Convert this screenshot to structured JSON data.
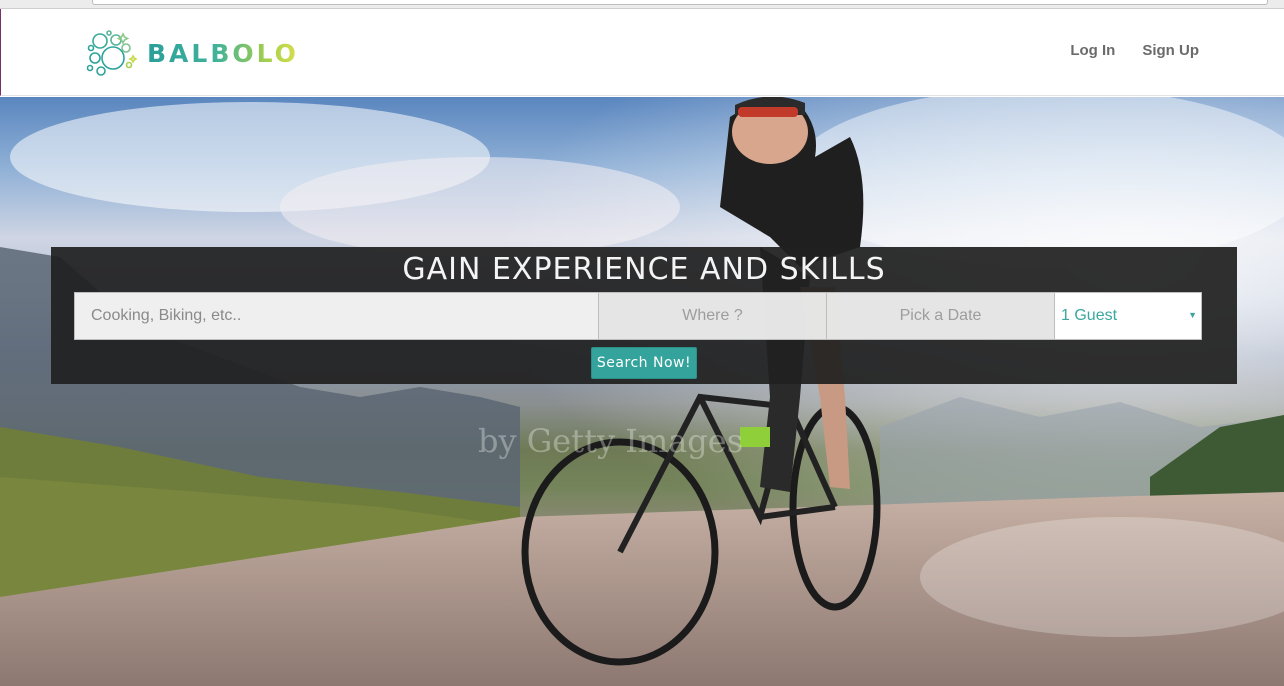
{
  "brand": {
    "name": "BALBOLO"
  },
  "nav": {
    "login_label": "Log In",
    "signup_label": "Sign Up"
  },
  "hero": {
    "title": "GAIN EXPERIENCE AND SKILLS",
    "watermark": "by Getty Images",
    "search": {
      "activity_placeholder": "Cooking, Biking, etc..",
      "location_placeholder": "Where ?",
      "date_placeholder": "Pick a Date",
      "guests_value": "1 Guest",
      "button_label": "Search Now!"
    }
  },
  "colors": {
    "accent": "#34a39c",
    "nav_text": "#6b6b6b",
    "panel": "#202020"
  },
  "icons": {
    "logo": "bubbles-logo-icon",
    "dropdown": "caret-down-icon"
  }
}
